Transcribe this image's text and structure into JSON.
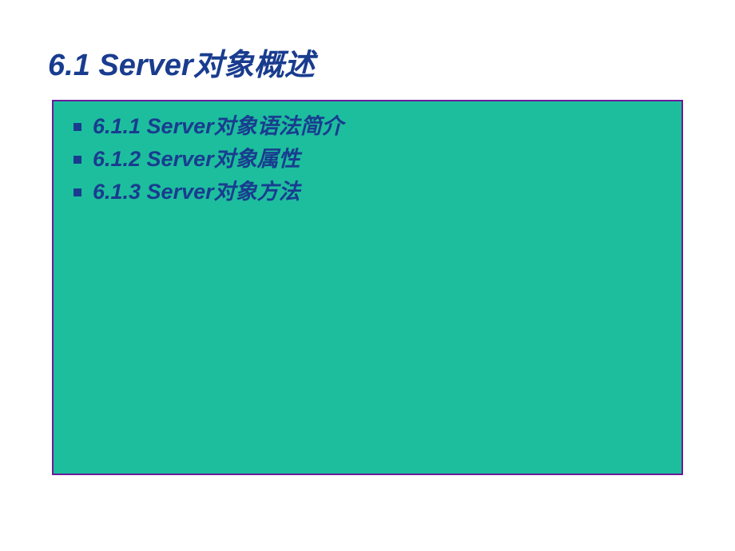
{
  "slide": {
    "title": "6.1  Server对象概述",
    "items": [
      {
        "text": "6.1.1  Server对象语法简介"
      },
      {
        "text": "6.1.2  Server对象属性"
      },
      {
        "text": "6.1.3  Server对象方法"
      }
    ],
    "pageIndicator": ""
  }
}
